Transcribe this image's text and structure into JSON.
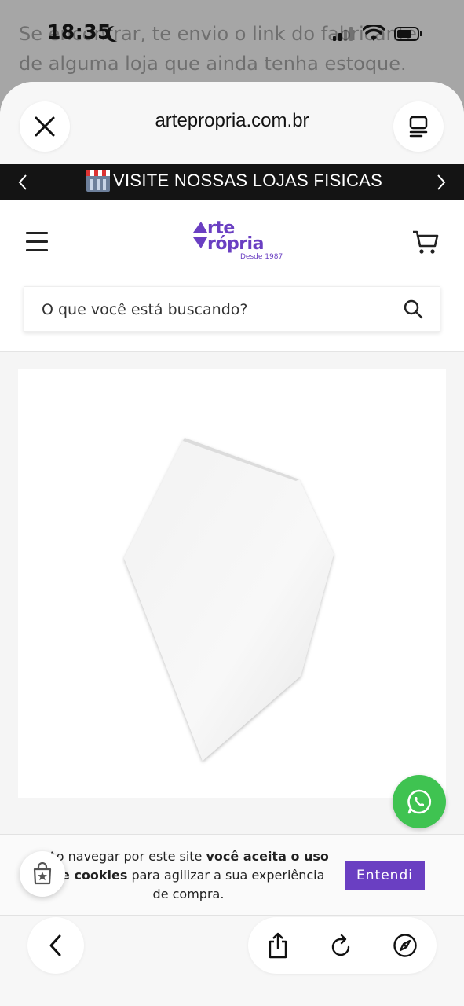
{
  "background_chat": {
    "line1": "Se encontrar, te envio o link do fabricante",
    "line2": "de alguma loja que ainda tenha estoque."
  },
  "status_bar": {
    "time": "18:35"
  },
  "browser": {
    "url": "artepropria.com.br",
    "close_icon": "close-icon",
    "menu_icon": "reader-menu-icon"
  },
  "announcement": {
    "text": "VISITE NOSSAS LOJAS FISICAS",
    "emoji": "department-store-emoji"
  },
  "site": {
    "logo_line1": "rte",
    "logo_line2": "rópria",
    "logo_sub": "Desde 1987",
    "search_placeholder": "O que você está buscando?",
    "brand_color": "#6a3fc2"
  },
  "cookie": {
    "text_part1": "Ao navegar por este site ",
    "text_bold1": "você aceita o uso de cookies",
    "text_part2": " para agilizar a sua experiência de compra.",
    "button": "Entendi"
  },
  "colors": {
    "whatsapp": "#3fc351",
    "announcement_bg": "#141414",
    "cookie_button": "#6a3fc2"
  }
}
